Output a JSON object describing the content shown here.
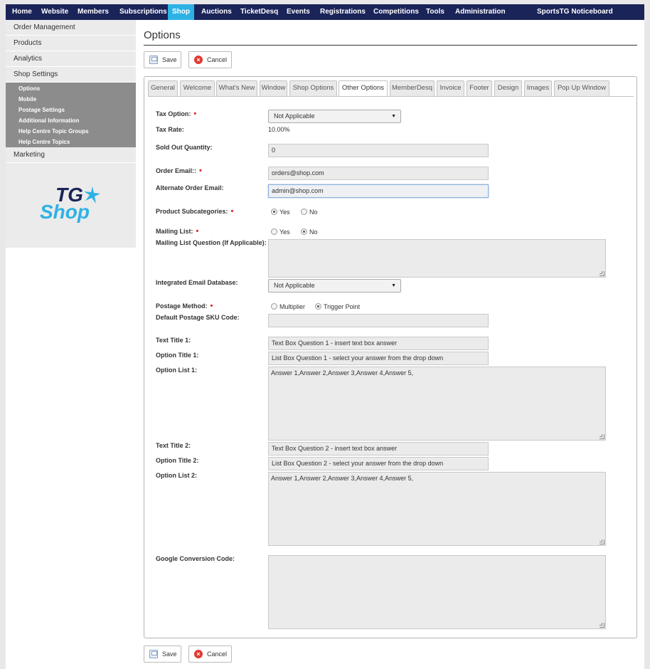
{
  "nav": {
    "items": [
      "Home",
      "Website",
      "Members",
      "Subscriptions",
      "Shop",
      "Auctions",
      "TicketDesq",
      "Events",
      "Registrations",
      "Competitions",
      "Tools",
      "Administration"
    ],
    "active": "Shop",
    "noticeboard": "SportsTG Noticeboard"
  },
  "sidebar": {
    "items": [
      "Order Management",
      "Products",
      "Analytics",
      "Shop Settings"
    ],
    "sub_items": [
      "Options",
      "Mobile",
      "Postage Settings",
      "Additional Information",
      "Help Centre Topic Groups",
      "Help Centre Topics"
    ],
    "after": "Marketing",
    "logo_line1": "TG",
    "logo_line2": "Shop"
  },
  "page_title": "Options",
  "buttons": {
    "save": "Save",
    "cancel": "Cancel"
  },
  "tabs": [
    "General",
    "Welcome",
    "What's New",
    "Window",
    "Shop Options",
    "Other Options",
    "MemberDesq",
    "Invoice",
    "Footer",
    "Design",
    "Images",
    "Pop Up Window"
  ],
  "active_tab": "Other Options",
  "form": {
    "tax_option": {
      "label": "Tax Option:",
      "value": "Not Applicable"
    },
    "tax_rate": {
      "label": "Tax Rate:",
      "value": "10.00%"
    },
    "sold_out": {
      "label": "Sold Out Quantity:",
      "value": "0"
    },
    "order_email": {
      "label": "Order Email::",
      "value": "orders@shop.com"
    },
    "alt_email": {
      "label": "Alternate Order Email:",
      "value": "admin@shop.com"
    },
    "subcategories": {
      "label": "Product Subcategories:",
      "yes": "Yes",
      "no": "No",
      "selected": "Yes"
    },
    "mailing_list": {
      "label": "Mailing List:",
      "yes": "Yes",
      "no": "No",
      "selected": "No"
    },
    "mailing_question": {
      "label": "Mailing List Question (If Applicable):",
      "value": ""
    },
    "email_db": {
      "label": "Integrated Email Database:",
      "value": "Not Applicable"
    },
    "postage_method": {
      "label": "Postage Method:",
      "opt1": "Multiplier",
      "opt2": "Trigger Point",
      "selected": "Trigger Point"
    },
    "default_sku": {
      "label": "Default Postage SKU Code:",
      "value": ""
    },
    "text_title_1": {
      "label": "Text Title 1:",
      "value": "Text Box Question 1 - insert text box answer"
    },
    "option_title_1": {
      "label": "Option Title 1:",
      "value": "List Box Question 1 - select your answer from the drop down"
    },
    "option_list_1": {
      "label": "Option List 1:",
      "value": "Answer 1,Answer 2,Answer 3,Answer 4,Answer 5,"
    },
    "text_title_2": {
      "label": "Text Title 2:",
      "value": "Text Box Question 2 - insert text box answer"
    },
    "option_title_2": {
      "label": "Option Title 2:",
      "value": "List Box Question 2 - select your answer from the drop down"
    },
    "option_list_2": {
      "label": "Option List 2:",
      "value": "Answer 1,Answer 2,Answer 3,Answer 4,Answer 5,"
    },
    "google_code": {
      "label": "Google Conversion Code:",
      "value": ""
    }
  },
  "colors": {
    "nav_bg": "#1a2459",
    "active": "#2db2e5",
    "required": "#e0262b"
  }
}
